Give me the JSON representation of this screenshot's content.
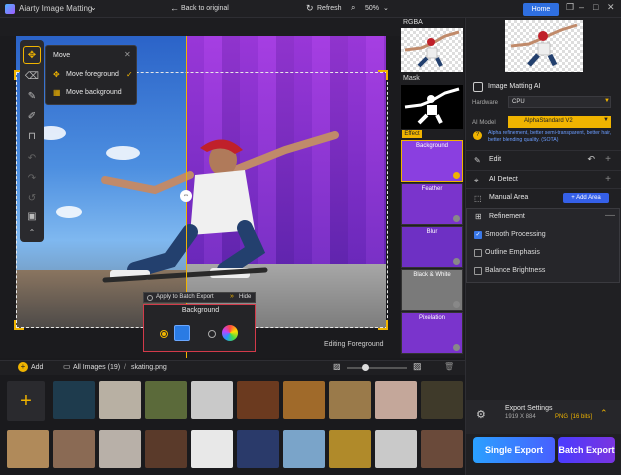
{
  "title_bar": {
    "app_title": "Aiarty Image Matting",
    "app_title_caret": "⌄",
    "home_label": "Home",
    "window_controls": [
      "❐",
      "–",
      "□",
      "✕"
    ]
  },
  "canvas_toolbar": {
    "back_label": "Back to original",
    "refresh_label": "Refresh",
    "zoom_label": "50%",
    "zoom_caret": "⌄"
  },
  "tools": [
    {
      "name": "move-icon",
      "glyph": "✥"
    },
    {
      "name": "eraser-icon",
      "glyph": "⌫"
    },
    {
      "name": "brush-icon",
      "glyph": "✎"
    },
    {
      "name": "sweep-brush-icon",
      "glyph": "✐"
    },
    {
      "name": "paint-roller-icon",
      "glyph": "⊓"
    },
    {
      "name": "undo-icon",
      "glyph": "↶"
    },
    {
      "name": "redo-icon",
      "glyph": "↷"
    },
    {
      "name": "reset-icon",
      "glyph": "↺"
    },
    {
      "name": "compare-icon",
      "glyph": "▣"
    },
    {
      "name": "collapse-icon",
      "glyph": "⌃"
    }
  ],
  "move_popup": {
    "title": "Move",
    "close": "✕",
    "option_foreground": "Move foreground",
    "option_background": "Move background",
    "check": "✓"
  },
  "batch_bar": {
    "apply_label": "Apply to Batch Export",
    "hide_chevron": "»",
    "hide_label": "Hide"
  },
  "background_panel": {
    "title": "Background"
  },
  "canvas_status": "Editing Foreground",
  "preview_column": {
    "rgba_label": "RGBA",
    "mask_label": "Mask",
    "effect_badge": "Effect",
    "effects": [
      {
        "label": "Background",
        "color": "#8a3fe0"
      },
      {
        "label": "Feather",
        "color": "#7a34cc"
      },
      {
        "label": "Blur",
        "color": "#6e30c4"
      },
      {
        "label": "Black & White",
        "color": "#7a7a7a"
      },
      {
        "label": "Pixelation",
        "color": "#7a34cc"
      }
    ]
  },
  "right_panel": {
    "matting_title": "Image Matting AI",
    "hardware_label": "Hardware",
    "hardware_value": "CPU",
    "model_label": "AI Model",
    "model_value": "AlphaStandard  V2",
    "model_help": "?",
    "model_desc": "Alpha refinement, better semi-transparent, better hair, better blending quality. (SOTA)",
    "sections": {
      "edit": "Edit",
      "ai_detect": "AI Detect",
      "manual_area": "Manual Area",
      "add_area": "+ Add Area"
    },
    "refinement": {
      "title": "Refinement",
      "minus": "—",
      "options": [
        {
          "label": "Smooth Processing",
          "checked": true
        },
        {
          "label": "Outline Emphasis",
          "checked": false
        },
        {
          "label": "Balance Brightness",
          "checked": false
        }
      ]
    },
    "export": {
      "title": "Export Settings",
      "size": "1919 X 884",
      "format": "PNG",
      "bits": "[16 bits]",
      "chevron": "⌃"
    },
    "single_export": "Single Export",
    "batch_export": "Batch Export"
  },
  "gallery": {
    "add_label": "Add",
    "add_icon": "+",
    "all_images": "All Images (19)",
    "separator": "/",
    "file_name": "skating.png",
    "add_tile": "+",
    "row1_colors": [
      "#2a2a2e",
      "#1e3b4d",
      "#b8b0a3",
      "#5b6a3a",
      "#c9c9c9",
      "#6b3a1f",
      "#a06a2a",
      "#9a7a4a",
      "#c4a79a",
      "#3f3a2a"
    ],
    "row2_colors": [
      "#b08a5a",
      "#8a6a54",
      "#b8b0a8",
      "#5a3a2a",
      "#e8e8e8",
      "#2a3a6a",
      "#7aa4c9",
      "#b08a2a",
      "#c9c9c9",
      "#6a4a3a"
    ]
  },
  "colors": {
    "accent": "#f0b400",
    "primary_blue": "#2f6fe0",
    "purple_bg": "#7a2fd0"
  }
}
